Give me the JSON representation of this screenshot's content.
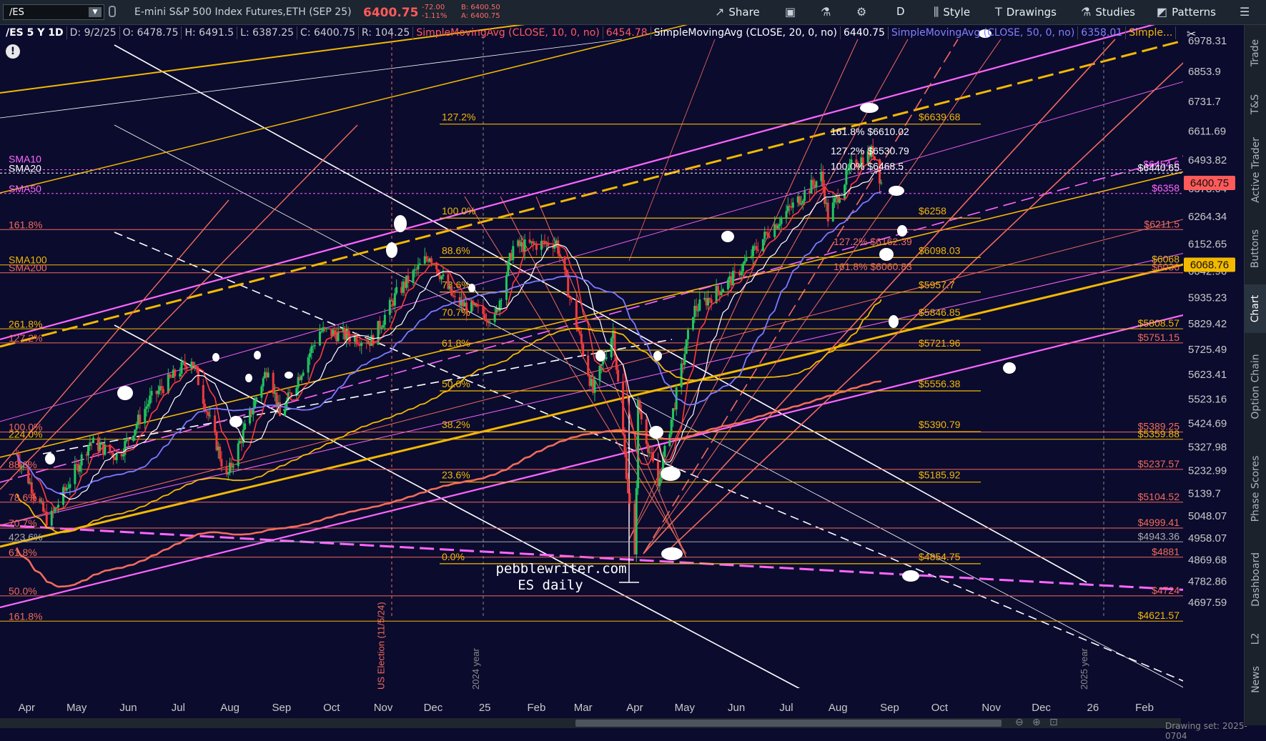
{
  "toolbar": {
    "symbol": "/ES",
    "instrument": "E-mini S&P 500 Index Futures,ETH (SEP 25)",
    "last_price": "6400.75",
    "change": "-72.00",
    "change_pct": "-1.11%",
    "bid": "B: 6400.50",
    "ask": "A: 6400.75",
    "share_label": "Share",
    "timeframe_label": "D",
    "style_label": "Style",
    "drawings_label": "Drawings",
    "studies_label": "Studies",
    "patterns_label": "Patterns"
  },
  "studybar": {
    "symbol": "/ES 5 Y 1D",
    "date": "D: 9/2/25",
    "open": "O: 6478.75",
    "high": "H: 6491.5",
    "low": "L: 6387.25",
    "close": "C: 6400.75",
    "range": "R: 104.25",
    "sma10": "SimpleMovingAvg (CLOSE, 10, 0, no)",
    "sma10_val": "6454.78",
    "sma20": "SimpleMovingAvg (CLOSE, 20, 0, no)",
    "sma20_val": "6440.75",
    "sma50": "SimpleMovingAvg (CLOSE, 50, 0, no)",
    "sma50_val": "6358.01",
    "more": "Simple..."
  },
  "right_tabs": [
    "Trade",
    "T&S",
    "Active Trader",
    "Buttons",
    "Chart",
    "Option Chain",
    "Phase Scores",
    "Dashboard",
    "L2",
    "News"
  ],
  "active_tab": "Chart",
  "bottom": {
    "drawing_set": "Drawing set: 2025-0704"
  },
  "watermark": {
    "line1": "pebblewriter.com",
    "line2": "ES daily"
  },
  "colors": {
    "background": "#0b0b2e",
    "gold": "#f2b900",
    "salmon": "#f26b5b",
    "magenta": "#ff66ff",
    "white": "#ffffff",
    "price_tag": "#ff5a5a"
  },
  "chart_data": {
    "type": "candlestick",
    "title": "/ES 5 Y 1D",
    "x_ticks": [
      "Apr",
      "May",
      "Jun",
      "Jul",
      "Aug",
      "Sep",
      "Oct",
      "Nov",
      "Dec",
      "25",
      "Feb",
      "Mar",
      "Apr",
      "May",
      "Jun",
      "Jul",
      "Aug",
      "Sep",
      "Oct",
      "Nov",
      "Dec",
      "26",
      "Feb"
    ],
    "y_ticks": [
      6978.31,
      6853.9,
      6731.7,
      6611.69,
      6493.82,
      6378.04,
      6264.34,
      6152.65,
      6042.96,
      5935.23,
      5829.42,
      5725.49,
      5623.41,
      5523.16,
      5424.69,
      5327.98,
      5232.99,
      5139.7,
      5048.07,
      4958.07,
      4869.68,
      4782.86,
      4697.59
    ],
    "ylim": [
      4620,
      7000
    ],
    "current_price": 6400.75,
    "price_tags": [
      {
        "label": "6400.75",
        "value": 6400.75,
        "color": "#ff5a5a"
      },
      {
        "label": "6068.76",
        "value": 6068.76,
        "color": "#f2b900"
      }
    ],
    "close_series": [
      {
        "x": "2024-04-01",
        "y": 5300
      },
      {
        "x": "2024-04-20",
        "y": 5020
      },
      {
        "x": "2024-05-15",
        "y": 5350
      },
      {
        "x": "2024-06-01",
        "y": 5290
      },
      {
        "x": "2024-06-20",
        "y": 5520
      },
      {
        "x": "2024-07-15",
        "y": 5690
      },
      {
        "x": "2024-08-05",
        "y": 5200
      },
      {
        "x": "2024-08-30",
        "y": 5660
      },
      {
        "x": "2024-09-06",
        "y": 5450
      },
      {
        "x": "2024-09-30",
        "y": 5800
      },
      {
        "x": "2024-10-31",
        "y": 5760
      },
      {
        "x": "2024-11-15",
        "y": 5950
      },
      {
        "x": "2024-12-05",
        "y": 6110
      },
      {
        "x": "2024-12-20",
        "y": 5920
      },
      {
        "x": "2025-01-13",
        "y": 5850
      },
      {
        "x": "2025-01-24",
        "y": 6140
      },
      {
        "x": "2025-02-19",
        "y": 6160
      },
      {
        "x": "2025-03-13",
        "y": 5550
      },
      {
        "x": "2025-03-25",
        "y": 5800
      },
      {
        "x": "2025-04-07",
        "y": 4870
      },
      {
        "x": "2025-04-09",
        "y": 5500
      },
      {
        "x": "2025-04-21",
        "y": 5170
      },
      {
        "x": "2025-05-12",
        "y": 5880
      },
      {
        "x": "2025-06-06",
        "y": 6020
      },
      {
        "x": "2025-06-27",
        "y": 6210
      },
      {
        "x": "2025-07-28",
        "y": 6430
      },
      {
        "x": "2025-08-01",
        "y": 6260
      },
      {
        "x": "2025-08-15",
        "y": 6470
      },
      {
        "x": "2025-08-28",
        "y": 6530
      },
      {
        "x": "2025-09-02",
        "y": 6400.75
      }
    ],
    "series": [
      {
        "name": "SMA20",
        "color": "#ffffff"
      },
      {
        "name": "SMA50",
        "color": "#7b7bff"
      },
      {
        "name": "SMA100",
        "color": "#f2b900"
      },
      {
        "name": "SMA200",
        "color": "#f26b5b"
      }
    ],
    "left_labels": [
      {
        "text": "SMA10",
        "value": 6478,
        "color": "#ff66ff"
      },
      {
        "text": "SMA20",
        "value": 6440,
        "color": "#ffffff"
      },
      {
        "text": "SMA50",
        "value": 6358,
        "color": "#ff66ff"
      },
      {
        "text": "161.8%",
        "value": 6211,
        "color": "#f26b5b"
      },
      {
        "text": "SMA100",
        "value": 6068,
        "color": "#f2b900"
      },
      {
        "text": "SMA200",
        "value": 6036,
        "color": "#f26b5b"
      },
      {
        "text": "261.8%",
        "value": 5808,
        "color": "#f2b900"
      },
      {
        "text": "127.2%",
        "value": 5751,
        "color": "#f26b5b"
      },
      {
        "text": "100.0%",
        "value": 5389,
        "color": "#f26b5b"
      },
      {
        "text": "224.0%",
        "value": 5360,
        "color": "#f2b900"
      },
      {
        "text": "88.6%",
        "value": 5237,
        "color": "#f26b5b"
      },
      {
        "text": "78.6%",
        "value": 5104,
        "color": "#f26b5b"
      },
      {
        "text": "70.7%",
        "value": 4999,
        "color": "#f26b5b"
      },
      {
        "text": "423.6%",
        "value": 4943,
        "color": "#aaaaaa"
      },
      {
        "text": "61.8%",
        "value": 4881,
        "color": "#f26b5b"
      },
      {
        "text": "50.0%",
        "value": 4724,
        "color": "#f26b5b"
      },
      {
        "text": "161.8%",
        "value": 4621,
        "color": "#f26b5b"
      }
    ],
    "fib_levels": [
      {
        "pct": "127.2%",
        "value": 6639.68,
        "label": "$6639.68"
      },
      {
        "pct": "100.0%",
        "value": 6258,
        "label": "$6258"
      },
      {
        "pct": "88.6%",
        "value": 6098.03,
        "label": "$6098.03"
      },
      {
        "pct": "78.6%",
        "value": 5957.7,
        "label": "$5957.7"
      },
      {
        "pct": "70.7%",
        "value": 5846.85,
        "label": "$5846.85"
      },
      {
        "pct": "61.8%",
        "value": 5721.96,
        "label": "$5721.96"
      },
      {
        "pct": "50.0%",
        "value": 5556.38,
        "label": "$5556.38"
      },
      {
        "pct": "38.2%",
        "value": 5390.79,
        "label": "$5390.79"
      },
      {
        "pct": "23.6%",
        "value": 5185.92,
        "label": "$5185.92"
      },
      {
        "pct": "0.0%",
        "value": 4854.75,
        "label": "$4854.75"
      }
    ],
    "right_levels": [
      {
        "label": "$6454.6",
        "value": 6454.6,
        "color": "#ff66ff"
      },
      {
        "label": "$6440.65",
        "value": 6440.65,
        "color": "#ffffff"
      },
      {
        "label": "$6358",
        "value": 6358,
        "color": "#ff66ff"
      },
      {
        "label": "$6211.5",
        "value": 6211.5,
        "color": "#f26b5b"
      },
      {
        "label": "$6068",
        "value": 6068,
        "color": "#f2b900"
      },
      {
        "label": "$6036",
        "value": 6036,
        "color": "#f26b5b"
      },
      {
        "label": "$5808.57",
        "value": 5808.57,
        "color": "#f2b900"
      },
      {
        "label": "$5751.15",
        "value": 5751.15,
        "color": "#f26b5b"
      },
      {
        "label": "$5389.25",
        "value": 5389.25,
        "color": "#f26b5b"
      },
      {
        "label": "$5359.88",
        "value": 5359.88,
        "color": "#f2b900"
      },
      {
        "label": "$5237.57",
        "value": 5237.57,
        "color": "#f26b5b"
      },
      {
        "label": "$5104.52",
        "value": 5104.52,
        "color": "#f26b5b"
      },
      {
        "label": "$4999.41",
        "value": 4999.41,
        "color": "#f26b5b"
      },
      {
        "label": "$4943.36",
        "value": 4943.36,
        "color": "#aaaaaa"
      },
      {
        "label": "$4881",
        "value": 4881,
        "color": "#f26b5b"
      },
      {
        "label": "$4724",
        "value": 4724,
        "color": "#f26b5b"
      },
      {
        "label": "$4621.57",
        "value": 4621.57,
        "color": "#f2b900"
      }
    ],
    "top_fib_labels": [
      {
        "text": "161.8% $6610.02",
        "value": 6610.02
      },
      {
        "text": "127.2% $6530.79",
        "value": 6530.79
      },
      {
        "text": "100.0% $6468.5",
        "value": 6468.5
      },
      {
        "text": "127.2% $6162.39",
        "value": 6162.39
      },
      {
        "text": "161.8% $6060.83",
        "value": 6060.83
      }
    ],
    "vertical_markers": [
      {
        "text": "US Election (11/5/24)",
        "x": "2024-11-05",
        "color": "#f26b5b"
      },
      {
        "text": "2024 year",
        "x": "2025-01-01",
        "color": "#888888"
      },
      {
        "text": "2025 year",
        "x": "2026-01-01",
        "color": "#888888"
      }
    ]
  }
}
